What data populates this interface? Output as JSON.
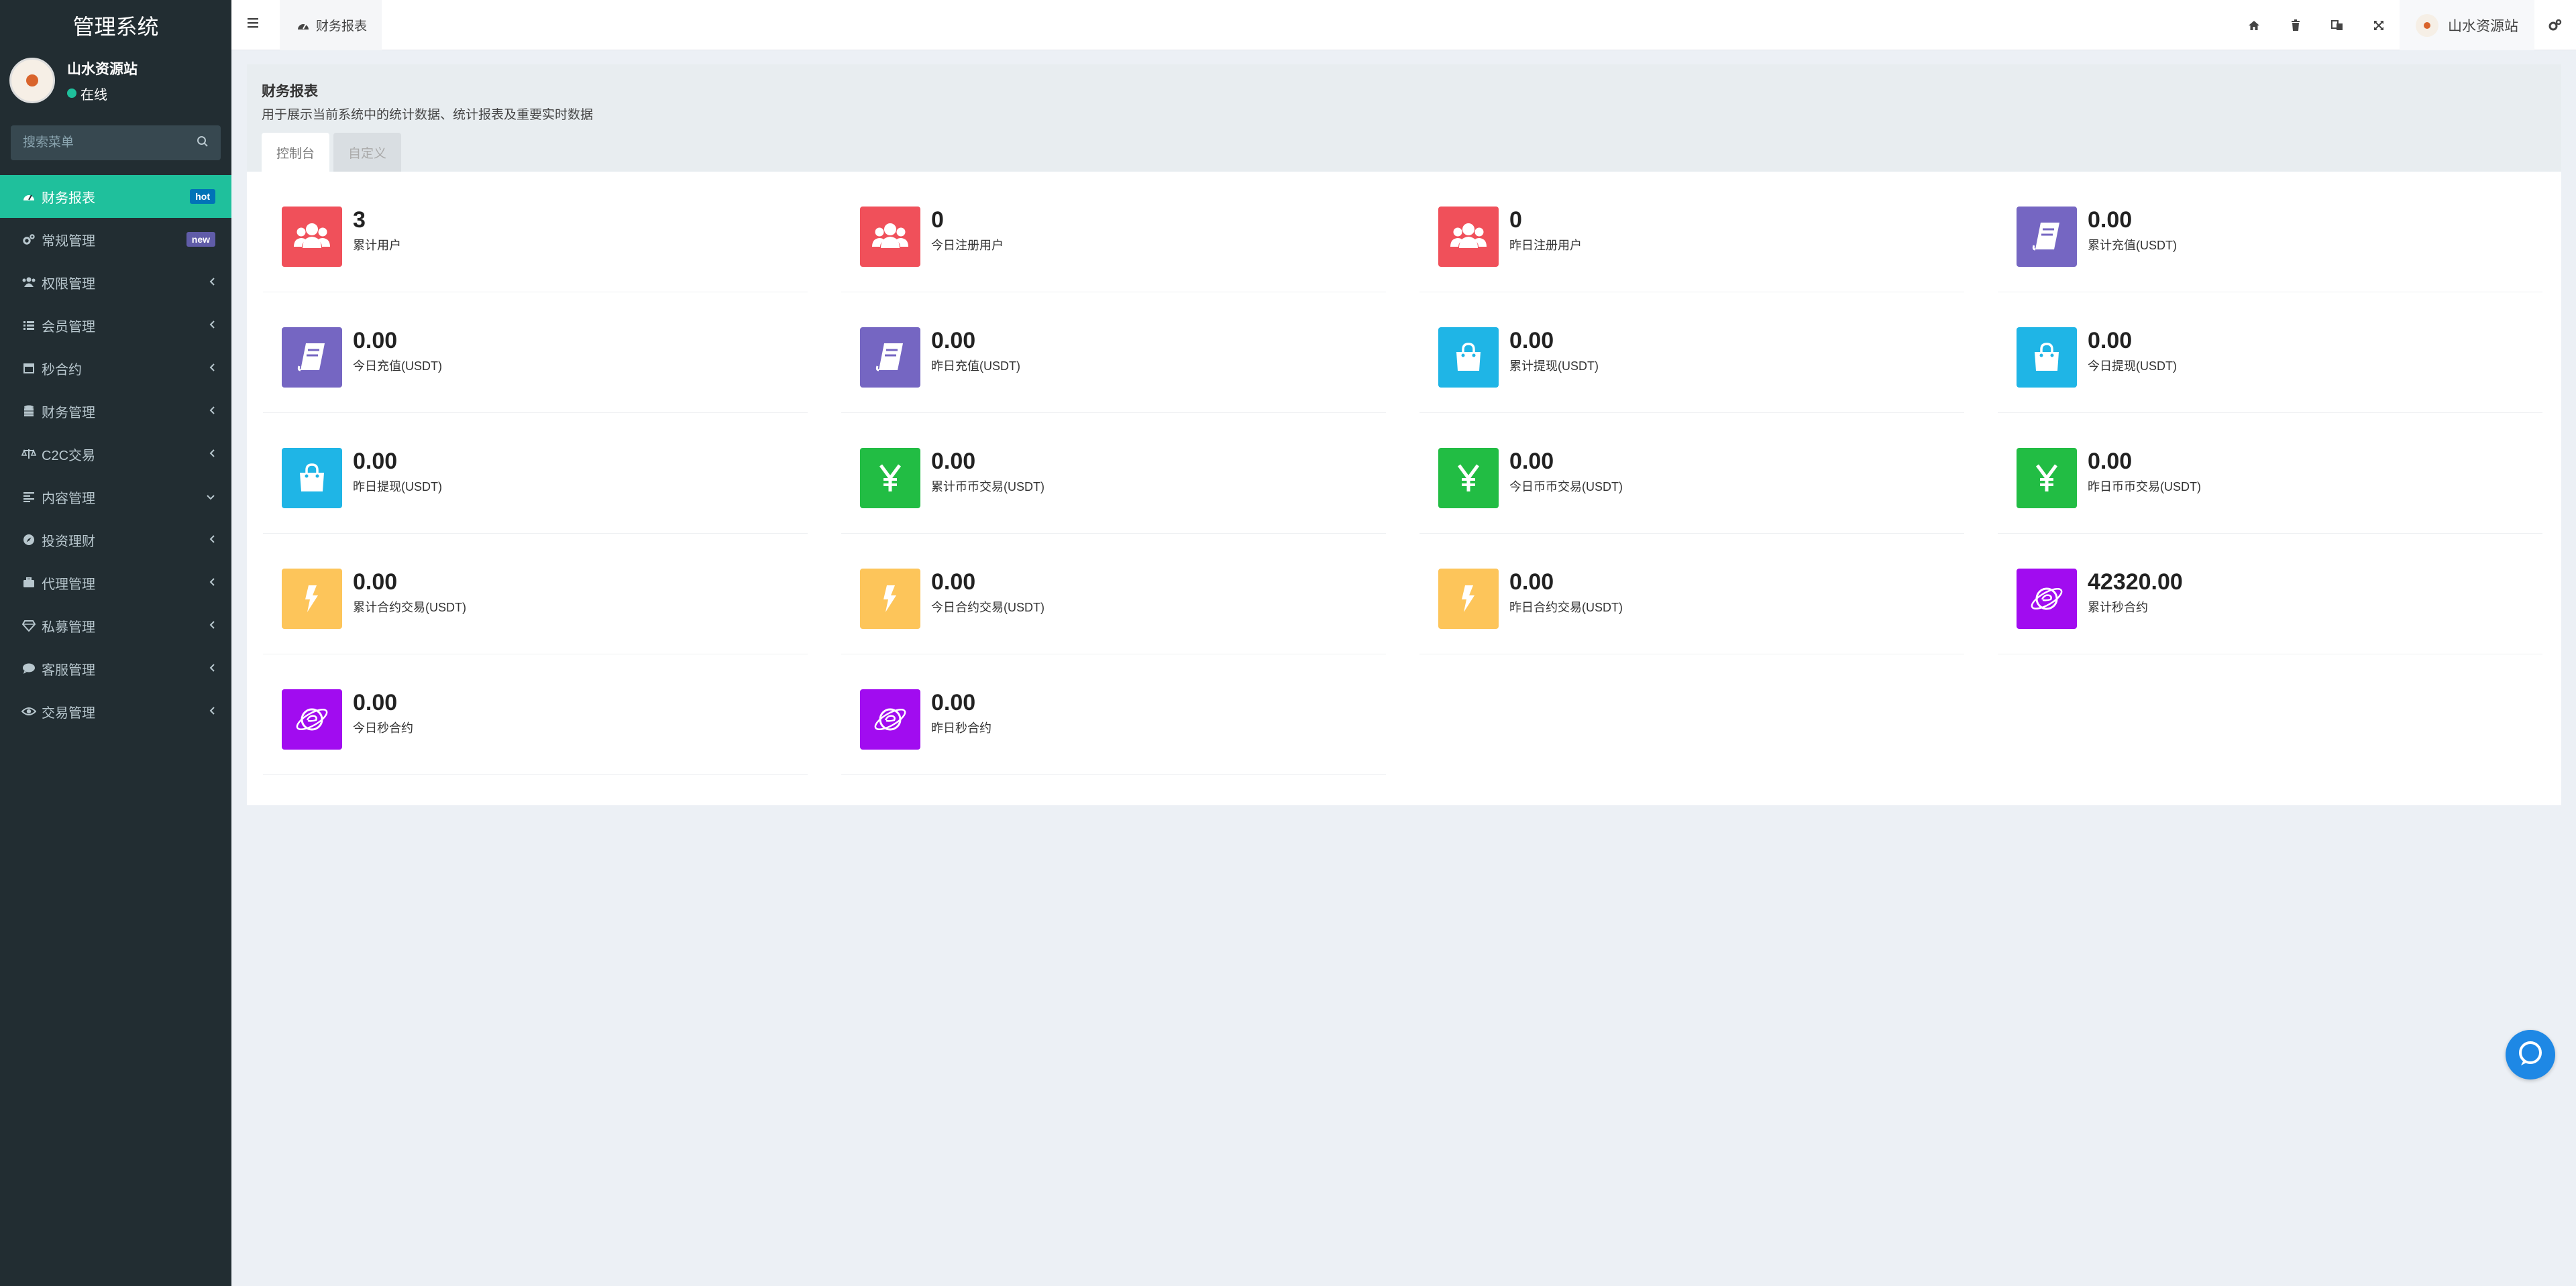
{
  "sidebar": {
    "app_title": "管理系统",
    "user": {
      "name": "山水资源站",
      "status": "在线"
    },
    "search_placeholder": "搜索菜单",
    "items": [
      {
        "label": "财务报表",
        "icon": "dashboard-icon",
        "badge": "hot",
        "active": true
      },
      {
        "label": "常规管理",
        "icon": "cogs-icon",
        "badge": "new"
      },
      {
        "label": "权限管理",
        "icon": "group-icon"
      },
      {
        "label": "会员管理",
        "icon": "list-icon"
      },
      {
        "label": "秒合约",
        "icon": "calendar-icon"
      },
      {
        "label": "财务管理",
        "icon": "database-icon"
      },
      {
        "label": "C2C交易",
        "icon": "balance-scale-icon"
      },
      {
        "label": "内容管理",
        "icon": "align-left-icon"
      },
      {
        "label": "投资理财",
        "icon": "compass-icon"
      },
      {
        "label": "代理管理",
        "icon": "briefcase-icon"
      },
      {
        "label": "私募管理",
        "icon": "diamond-icon"
      },
      {
        "label": "客服管理",
        "icon": "comment-icon"
      },
      {
        "label": "交易管理",
        "icon": "eye-icon"
      }
    ]
  },
  "header": {
    "tab_label": "财务报表",
    "user_name": "山水资源站"
  },
  "main": {
    "title": "财务报表",
    "description": "用于展示当前系统中的统计数据、统计报表及重要实时数据",
    "tabs": [
      "控制台",
      "自定义"
    ],
    "stats": [
      {
        "value": "3",
        "label": "累计用户",
        "icon": "users-icon",
        "color": "#f0505a"
      },
      {
        "value": "0",
        "label": "今日注册用户",
        "icon": "users-icon",
        "color": "#f0505a"
      },
      {
        "value": "0",
        "label": "昨日注册用户",
        "icon": "users-icon",
        "color": "#f0505a"
      },
      {
        "value": "0.00",
        "label": "累计充值(USDT)",
        "icon": "book-icon",
        "color": "#7566c2"
      },
      {
        "value": "0.00",
        "label": "今日充值(USDT)",
        "icon": "book-icon",
        "color": "#7566c2"
      },
      {
        "value": "0.00",
        "label": "昨日充值(USDT)",
        "icon": "book-icon",
        "color": "#7566c2"
      },
      {
        "value": "0.00",
        "label": "累计提现(USDT)",
        "icon": "shopping-bag-icon",
        "color": "#1fb5e6"
      },
      {
        "value": "0.00",
        "label": "今日提现(USDT)",
        "icon": "shopping-bag-icon",
        "color": "#1fb5e6"
      },
      {
        "value": "0.00",
        "label": "昨日提现(USDT)",
        "icon": "shopping-bag-icon",
        "color": "#1fb5e6"
      },
      {
        "value": "0.00",
        "label": "累计币币交易(USDT)",
        "icon": "yen-icon",
        "color": "#22bd44"
      },
      {
        "value": "0.00",
        "label": "今日币币交易(USDT)",
        "icon": "yen-icon",
        "color": "#22bd44"
      },
      {
        "value": "0.00",
        "label": "昨日币币交易(USDT)",
        "icon": "yen-icon",
        "color": "#22bd44"
      },
      {
        "value": "0.00",
        "label": "累计合约交易(USDT)",
        "icon": "bolt-icon",
        "color": "#fdc55a"
      },
      {
        "value": "0.00",
        "label": "今日合约交易(USDT)",
        "icon": "bolt-icon",
        "color": "#fdc55a"
      },
      {
        "value": "0.00",
        "label": "昨日合约交易(USDT)",
        "icon": "bolt-icon",
        "color": "#fdc55a"
      },
      {
        "value": "42320.00",
        "label": "累计秒合约",
        "icon": "planet-icon",
        "color": "#a10cf0"
      },
      {
        "value": "0.00",
        "label": "今日秒合约",
        "icon": "planet-icon",
        "color": "#a10cf0"
      },
      {
        "value": "0.00",
        "label": "昨日秒合约",
        "icon": "planet-icon",
        "color": "#a10cf0"
      }
    ]
  }
}
